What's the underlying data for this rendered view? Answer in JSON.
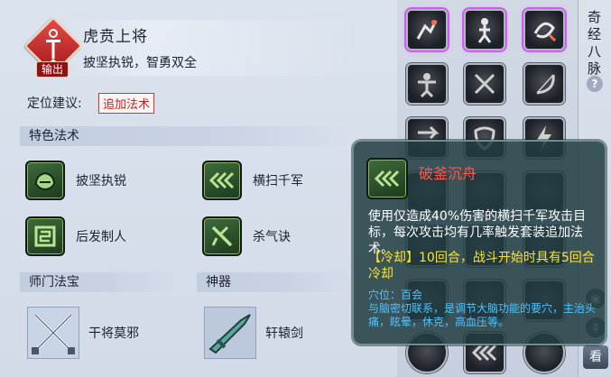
{
  "school": {
    "role_badge": "输出",
    "name": "虎贲上将",
    "motto": "披坚执锐，智勇双全"
  },
  "positioning": {
    "label": "定位建议:",
    "tag": "追加法术"
  },
  "featured": {
    "heading": "特色法术",
    "skills": [
      {
        "label": "披坚执锐",
        "icon": "rock-shield-icon"
      },
      {
        "label": "横扫千军",
        "icon": "triple-chevron-icon"
      },
      {
        "label": "后发制人",
        "icon": "counter-glyph-icon"
      },
      {
        "label": "杀气诀",
        "icon": "crossed-blades-icon"
      }
    ]
  },
  "treasure": {
    "heading": "师门法宝",
    "name": "干将莫邪"
  },
  "artifact": {
    "heading": "神器",
    "name": "轩辕剑"
  },
  "sidetab": {
    "title": "奇经八脉",
    "help": "?",
    "view_button": "看"
  },
  "tooltip": {
    "name": "破釜沉舟",
    "description": "使用仅造成40%伤害的横扫千军攻击目标，每次攻击均有几率触发套装追加法术。",
    "cooldown": "【冷却】10回合，战斗开始时具有5回合冷却",
    "acupoint": "穴位：百会",
    "acupoint_note": "与脑密切联系，是调节大脑功能的要穴，主治头痛，眩晕，休克，高血压等。"
  },
  "colors": {
    "accent_red": "#c81e1e",
    "tooltip_title": "#ff5a4a",
    "tooltip_cooldown": "#ffe234",
    "tooltip_acupoint": "#4fc3ff",
    "lit_glow": "#d15cf0"
  }
}
